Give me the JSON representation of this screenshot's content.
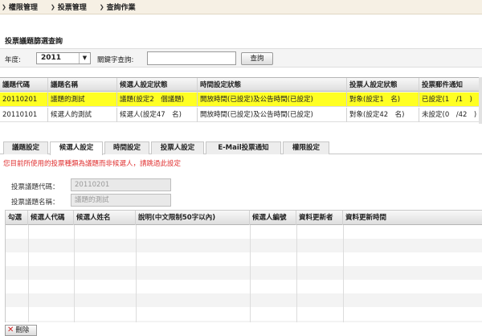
{
  "breadcrumb": [
    "權限管理",
    "投票管理",
    "查詢作業"
  ],
  "search": {
    "title": "投票議題篩選查詢",
    "year_label": "年度:",
    "year_value": "2011",
    "keyword_label": "關鍵字查詢:",
    "keyword_value": "",
    "query_button": "查詢"
  },
  "topics_grid": {
    "headers": [
      "議題代碼",
      "議題名稱",
      "候選人設定狀態",
      "時間設定狀態",
      "投票人設定狀態",
      "投票郵件通知"
    ],
    "rows": [
      [
        "20110201",
        "議題的測試",
        "議題(設定2　個議題)",
        "開放時間(已設定)及公告時間(已設定)",
        "對象(設定1　名)",
        "已設定(1　/1　)"
      ],
      [
        "20110101",
        "候選人的測試",
        "候選人(設定47　名)",
        "開放時間(已設定)及公告時間(已設定)",
        "對象(設定42　名)",
        "未設定(0　/42　)"
      ]
    ],
    "selected_row": 0
  },
  "tabs": [
    "議題設定",
    "候選人設定",
    "時間設定",
    "投票人設定",
    "E-Mail投票通知",
    "權限設定"
  ],
  "active_tab": 1,
  "notice": "您目前所使用的投票種類為議題而非候選人，請跳過此設定",
  "form": {
    "code_label": "投票議題代碼：",
    "code_value": "20110201",
    "name_label": "投票議題名稱：",
    "name_value": "議題的測試"
  },
  "candidates_grid": {
    "headers": [
      "勾選",
      "候選人代碼",
      "候選人姓名",
      "說明(中文限制50字以內)",
      "候選人編號",
      "資料更新者",
      "資料更新時間"
    ]
  },
  "delete_button": "刪除"
}
